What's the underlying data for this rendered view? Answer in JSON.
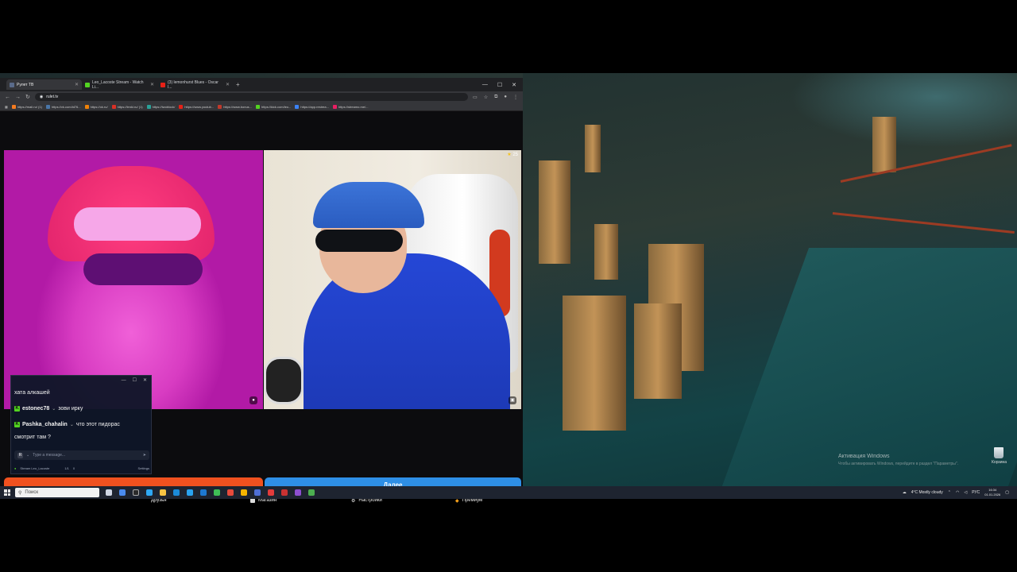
{
  "browser": {
    "tabs": [
      {
        "label": "Рулет ТВ",
        "color": "#5a6b8a",
        "active": true
      },
      {
        "label": "Leo_Lacoste Stream - Watch Li...",
        "color": "#53d321",
        "active": false
      },
      {
        "label": "(3) lemonhurst Blues - Oscar I...",
        "color": "#e62117",
        "active": false
      }
    ],
    "new_tab": "+",
    "window_controls": {
      "minimize": "—",
      "maximize": "☐",
      "close": "✕"
    },
    "url": "rulet.tv",
    "bookmarks": [
      {
        "label": "https://mail.ru/ (1)",
        "color": "#f47b20"
      },
      {
        "label": "https://vk.com/id76...",
        "color": "#4a76a8"
      },
      {
        "label": "https://ok.ru/",
        "color": "#ee8208"
      },
      {
        "label": "https://lenki.ru/ (1)",
        "color": "#d93025"
      },
      {
        "label": "https://twoblock/",
        "color": "#2aa198"
      },
      {
        "label": "https://www.youtub...",
        "color": "#e62117"
      },
      {
        "label": "https://www.bonus...",
        "color": "#c0392b"
      },
      {
        "label": "https://kick.com/leo...",
        "color": "#53d321"
      },
      {
        "label": "https://app.restrea...",
        "color": "#3b82f6"
      },
      {
        "label": "https://streamo.me/...",
        "color": "#e91e63"
      }
    ]
  },
  "page": {
    "star_count": "25",
    "start_label": "Далее",
    "nav": [
      {
        "label": "Друзья",
        "icon": "friends-icon"
      },
      {
        "label": "Магазин",
        "icon": "shop-icon"
      },
      {
        "label": "Настройки",
        "icon": "gear-icon"
      },
      {
        "label": "Премиум",
        "icon": "premium-icon"
      }
    ]
  },
  "chat": {
    "messages": [
      {
        "user": "",
        "text": "хата алкашей"
      },
      {
        "user": "estonec78",
        "text": "зови ирку"
      },
      {
        "user": "Pashka_chahalin",
        "text": "что этот пидорас"
      },
      {
        "user": "",
        "text": "смотрит там ?"
      }
    ],
    "input_avatar": "R",
    "input_placeholder": "Type a message...",
    "footer_channel": "Stream Leo_Lacoste",
    "footer_count1": "1/1",
    "footer_count2": "0",
    "footer_settings": "Settings"
  },
  "desktop": {
    "activation_title": "Активация Windows",
    "activation_sub": "Чтобы активировать Windows, перейдите в раздел \"Параметры\".",
    "trash_label": "Корзина"
  },
  "taskbar": {
    "search_placeholder": "Поиск",
    "weather": "4°C  Mostly cloudy",
    "lang": "РУС",
    "time": "16:34",
    "date": "01.01.2026"
  }
}
